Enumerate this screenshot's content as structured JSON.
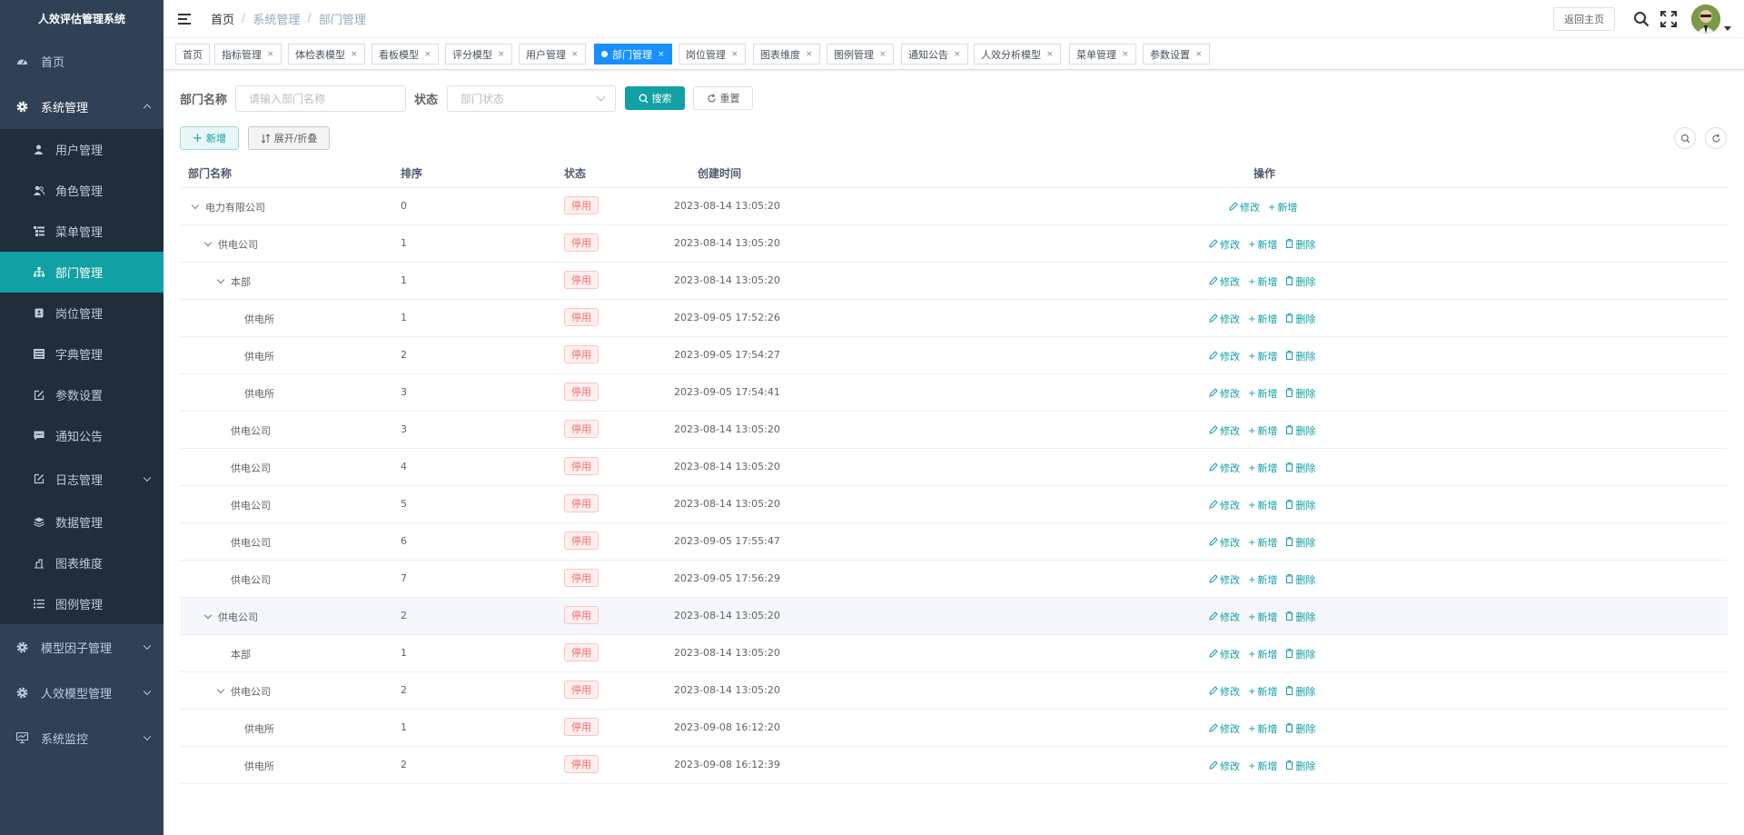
{
  "app": {
    "title": "人效评估管理系统"
  },
  "sidebar": {
    "items": [
      {
        "label": "首页",
        "icon": "dashboard-icon"
      },
      {
        "label": "系统管理",
        "icon": "gear-icon",
        "open": true,
        "children": [
          {
            "label": "用户管理",
            "icon": "user-icon"
          },
          {
            "label": "角色管理",
            "icon": "peoples-icon"
          },
          {
            "label": "菜单管理",
            "icon": "tree-table-icon"
          },
          {
            "label": "部门管理",
            "icon": "tree-icon",
            "active": true
          },
          {
            "label": "岗位管理",
            "icon": "post-icon"
          },
          {
            "label": "字典管理",
            "icon": "dict-icon"
          },
          {
            "label": "参数设置",
            "icon": "edit-icon"
          },
          {
            "label": "通知公告",
            "icon": "message-icon"
          },
          {
            "label": "日志管理",
            "icon": "log-icon"
          },
          {
            "label": "数据管理",
            "icon": "layers-icon"
          },
          {
            "label": "图表维度",
            "icon": "chart-icon"
          },
          {
            "label": "图例管理",
            "icon": "list-icon"
          }
        ]
      },
      {
        "label": "模型因子管理",
        "icon": "gear-icon"
      },
      {
        "label": "人效模型管理",
        "icon": "gear-icon"
      },
      {
        "label": "系统监控",
        "icon": "monitor-icon"
      }
    ]
  },
  "header": {
    "breadcrumb": [
      "首页",
      "系统管理",
      "部门管理"
    ],
    "back_label": "返回主页"
  },
  "tags": [
    "首页",
    "指标管理",
    "体检表模型",
    "看板模型",
    "评分模型",
    "用户管理",
    "部门管理",
    "岗位管理",
    "图表维度",
    "图例管理",
    "通知公告",
    "人效分析模型",
    "菜单管理",
    "参数设置"
  ],
  "active_tag": "部门管理",
  "search": {
    "name_label": "部门名称",
    "name_placeholder": "请输入部门名称",
    "status_label": "状态",
    "status_placeholder": "部门状态",
    "search_btn": "搜索",
    "reset_btn": "重置"
  },
  "toolbar": {
    "add_btn": "新增",
    "expand_btn": "展开/折叠"
  },
  "table": {
    "columns": [
      "部门名称",
      "排序",
      "状态",
      "创建时间",
      "操作"
    ],
    "op_labels": {
      "edit": "修改",
      "add": "新增",
      "delete": "删除"
    },
    "rows": [
      {
        "name": "电力有限公司",
        "level": 0,
        "expanded": true,
        "sort": "0",
        "status": "停用",
        "time": "2023-08-14 13:05:20",
        "deletable": false
      },
      {
        "name": "供电公司",
        "level": 1,
        "expanded": true,
        "sort": "1",
        "status": "停用",
        "time": "2023-08-14 13:05:20",
        "deletable": true
      },
      {
        "name": "本部",
        "level": 2,
        "expanded": true,
        "sort": "1",
        "status": "停用",
        "time": "2023-08-14 13:05:20",
        "deletable": true
      },
      {
        "name": "供电所",
        "level": 3,
        "expanded": false,
        "sort": "1",
        "status": "停用",
        "time": "2023-09-05 17:52:26",
        "deletable": true
      },
      {
        "name": "供电所",
        "level": 3,
        "expanded": false,
        "sort": "2",
        "status": "停用",
        "time": "2023-09-05 17:54:27",
        "deletable": true
      },
      {
        "name": "供电所",
        "level": 3,
        "expanded": false,
        "sort": "3",
        "status": "停用",
        "time": "2023-09-05 17:54:41",
        "deletable": true
      },
      {
        "name": "供电公司",
        "level": 2,
        "expanded": false,
        "sort": "3",
        "status": "停用",
        "time": "2023-08-14 13:05:20",
        "deletable": true
      },
      {
        "name": "供电公司",
        "level": 2,
        "expanded": false,
        "sort": "4",
        "status": "停用",
        "time": "2023-08-14 13:05:20",
        "deletable": true
      },
      {
        "name": "供电公司",
        "level": 2,
        "expanded": false,
        "sort": "5",
        "status": "停用",
        "time": "2023-08-14 13:05:20",
        "deletable": true
      },
      {
        "name": "供电公司",
        "level": 2,
        "expanded": false,
        "sort": "6",
        "status": "停用",
        "time": "2023-09-05 17:55:47",
        "deletable": true
      },
      {
        "name": "供电公司",
        "level": 2,
        "expanded": false,
        "sort": "7",
        "status": "停用",
        "time": "2023-09-05 17:56:29",
        "deletable": true
      },
      {
        "name": "供电公司",
        "level": 1,
        "expanded": true,
        "sort": "2",
        "status": "停用",
        "time": "2023-08-14 13:05:20",
        "deletable": true,
        "highlight": true
      },
      {
        "name": "本部",
        "level": 2,
        "expanded": false,
        "sort": "1",
        "status": "停用",
        "time": "2023-08-14 13:05:20",
        "deletable": true
      },
      {
        "name": "供电公司",
        "level": 2,
        "expanded": true,
        "sort": "2",
        "status": "停用",
        "time": "2023-08-14 13:05:20",
        "deletable": true
      },
      {
        "name": "供电所",
        "level": 3,
        "expanded": false,
        "sort": "1",
        "status": "停用",
        "time": "2023-09-08 16:12:20",
        "deletable": true
      },
      {
        "name": "供电所",
        "level": 3,
        "expanded": false,
        "sort": "2",
        "status": "停用",
        "time": "2023-09-08 16:12:39",
        "deletable": true
      }
    ]
  },
  "colors": {
    "accent": "#11a0a3",
    "sidebar_bg": "#304156",
    "tag_active": "#1890ff",
    "danger": "#f56c6c"
  }
}
